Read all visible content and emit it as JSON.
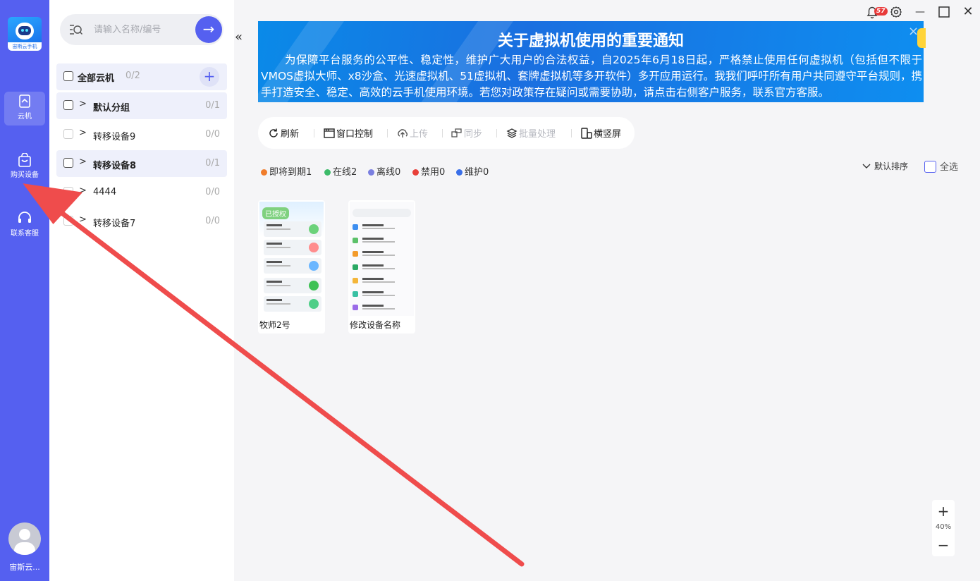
{
  "app": {
    "logo_caption": "宙斯云手机",
    "user_name": "宙斯云..."
  },
  "rail": [
    {
      "label": "云机",
      "icon": "cloud-phone-icon"
    },
    {
      "label": "购买设备",
      "icon": "shopping-bag-icon"
    },
    {
      "label": "联系客服",
      "icon": "headset-icon"
    }
  ],
  "search": {
    "placeholder": "请输入名称/编号",
    "go": "→"
  },
  "groups_header": {
    "label": "全部云机",
    "count": "0/2",
    "add": "+"
  },
  "groups": [
    {
      "name": "默认分组",
      "count": "0/1"
    },
    {
      "name": "转移设备9",
      "count": "0/0"
    },
    {
      "name": "转移设备8",
      "count": "0/1"
    },
    {
      "name": "4444",
      "count": "0/0"
    },
    {
      "name": "转移设备7",
      "count": "0/0"
    }
  ],
  "collapse": "«",
  "banner": {
    "title": "关于虚拟机使用的重要通知",
    "body": "为保障平台服务的公平性、稳定性，维护广大用户的合法权益，自2025年6月18日起，严格禁止使用任何虚拟机（包括但不限于VMOS虚拟大师、x8沙盒、光速虚拟机、51虚拟机、套牌虚拟机等多开软件）多开应用运行。我我们呼吁所有用户共同遵守平台规则，携手打造安全、稳定、高效的云手机使用环境。若您对政策存在疑问或需要协助，请点击右侧客户服务，联系官方客服。",
    "close": "×"
  },
  "toolbar": {
    "refresh": "刷新",
    "window": "窗口控制",
    "upload": "上传",
    "sync": "同步",
    "batch": "批量处理",
    "orient": "横竖屏"
  },
  "status": [
    {
      "label": "即将到期1",
      "color": "#f07d2c"
    },
    {
      "label": "在线2",
      "color": "#3dbb6a"
    },
    {
      "label": "离线0",
      "color": "#7a7fe0"
    },
    {
      "label": "禁用0",
      "color": "#e8403a"
    },
    {
      "label": "维护0",
      "color": "#3a6fe8"
    }
  ],
  "sort": {
    "label": "默认排序"
  },
  "select_all": "全选",
  "devices": [
    {
      "name": "牧师2号",
      "badge": "已授权"
    },
    {
      "name": "修改设备名称"
    }
  ],
  "zoom": {
    "plus": "+",
    "value": "40%",
    "minus": "−"
  },
  "notif_badge": "57",
  "win": {
    "minimize": "—",
    "close": "✕"
  }
}
